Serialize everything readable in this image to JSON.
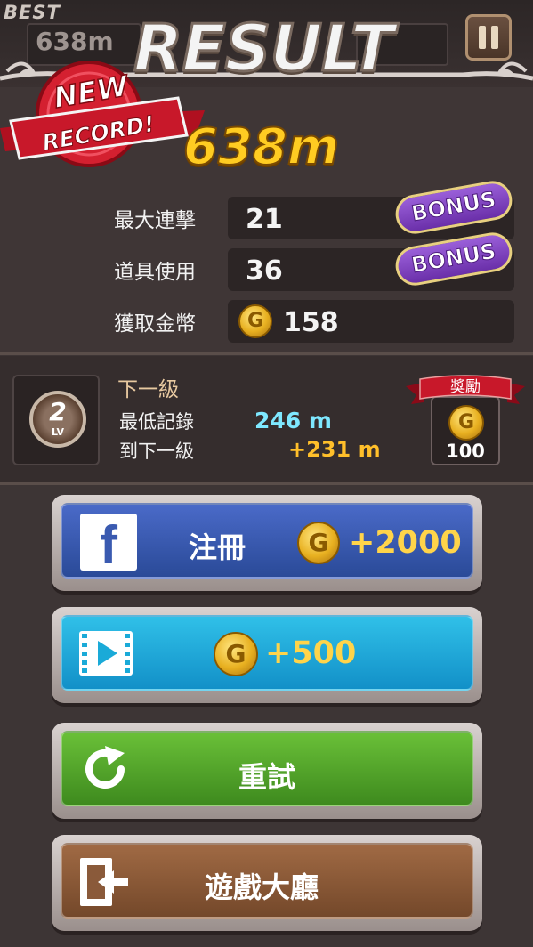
{
  "header": {
    "best_label": "BEST",
    "best_value": "638m",
    "title": "RESULT",
    "pause_icon": "pause-icon"
  },
  "result": {
    "new_record_line1": "NEW",
    "new_record_line2": "RECORD!",
    "distance": "638m",
    "stats": [
      {
        "label": "最大連擊",
        "value": "21",
        "bonus": "BONUS"
      },
      {
        "label": "道具使用",
        "value": "36",
        "bonus": "BONUS"
      },
      {
        "label": "獲取金幣",
        "value": "158",
        "icon": "gold-coin-icon"
      }
    ]
  },
  "level": {
    "badge_number": "2",
    "badge_text": "LV",
    "next_level_title": "下一級",
    "min_record_label": "最低記錄",
    "min_record_value": "246 m",
    "to_next_label": "到下一級",
    "to_next_value": "+231 m",
    "reward_label": "獎勵",
    "reward_value": "100"
  },
  "buttons": {
    "facebook": {
      "label": "注冊",
      "reward": "+2000",
      "icon": "facebook-icon",
      "color": "#3a5ab0"
    },
    "video": {
      "reward": "+500",
      "icon": "video-play-icon",
      "color": "#1aaad8"
    },
    "retry": {
      "label": "重試",
      "icon": "refresh-icon",
      "color": "#55a02a"
    },
    "lobby": {
      "label": "遊戲大廳",
      "icon": "exit-lobby-icon",
      "color": "#8a5a3a"
    }
  },
  "colors": {
    "background": "#3d3535",
    "score": "#ffcc22",
    "min_record": "#7ee8ff",
    "to_next": "#ffbf2a",
    "bonus": "#7a3fc0"
  }
}
